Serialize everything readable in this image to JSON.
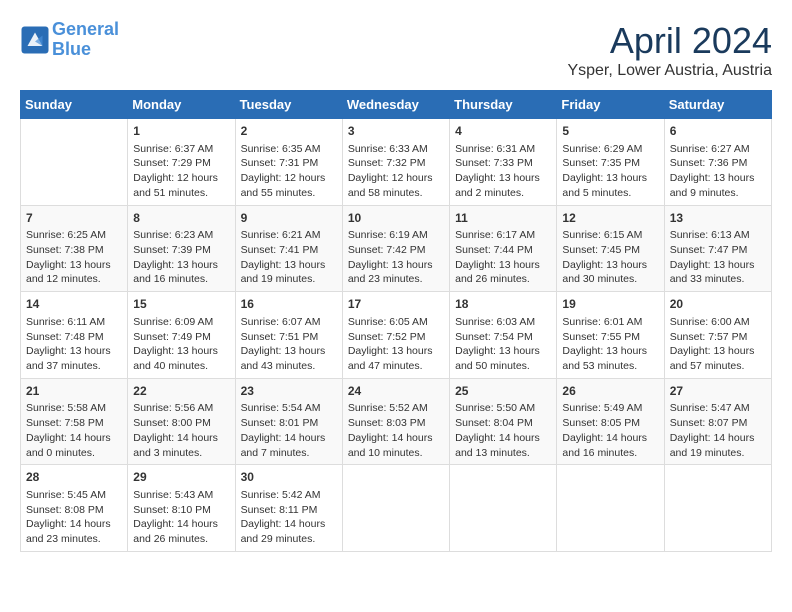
{
  "header": {
    "logo_line1": "General",
    "logo_line2": "Blue",
    "month": "April 2024",
    "location": "Ysper, Lower Austria, Austria"
  },
  "days_of_week": [
    "Sunday",
    "Monday",
    "Tuesday",
    "Wednesday",
    "Thursday",
    "Friday",
    "Saturday"
  ],
  "weeks": [
    [
      {
        "day": "",
        "info": ""
      },
      {
        "day": "1",
        "info": "Sunrise: 6:37 AM\nSunset: 7:29 PM\nDaylight: 12 hours\nand 51 minutes."
      },
      {
        "day": "2",
        "info": "Sunrise: 6:35 AM\nSunset: 7:31 PM\nDaylight: 12 hours\nand 55 minutes."
      },
      {
        "day": "3",
        "info": "Sunrise: 6:33 AM\nSunset: 7:32 PM\nDaylight: 12 hours\nand 58 minutes."
      },
      {
        "day": "4",
        "info": "Sunrise: 6:31 AM\nSunset: 7:33 PM\nDaylight: 13 hours\nand 2 minutes."
      },
      {
        "day": "5",
        "info": "Sunrise: 6:29 AM\nSunset: 7:35 PM\nDaylight: 13 hours\nand 5 minutes."
      },
      {
        "day": "6",
        "info": "Sunrise: 6:27 AM\nSunset: 7:36 PM\nDaylight: 13 hours\nand 9 minutes."
      }
    ],
    [
      {
        "day": "7",
        "info": "Sunrise: 6:25 AM\nSunset: 7:38 PM\nDaylight: 13 hours\nand 12 minutes."
      },
      {
        "day": "8",
        "info": "Sunrise: 6:23 AM\nSunset: 7:39 PM\nDaylight: 13 hours\nand 16 minutes."
      },
      {
        "day": "9",
        "info": "Sunrise: 6:21 AM\nSunset: 7:41 PM\nDaylight: 13 hours\nand 19 minutes."
      },
      {
        "day": "10",
        "info": "Sunrise: 6:19 AM\nSunset: 7:42 PM\nDaylight: 13 hours\nand 23 minutes."
      },
      {
        "day": "11",
        "info": "Sunrise: 6:17 AM\nSunset: 7:44 PM\nDaylight: 13 hours\nand 26 minutes."
      },
      {
        "day": "12",
        "info": "Sunrise: 6:15 AM\nSunset: 7:45 PM\nDaylight: 13 hours\nand 30 minutes."
      },
      {
        "day": "13",
        "info": "Sunrise: 6:13 AM\nSunset: 7:47 PM\nDaylight: 13 hours\nand 33 minutes."
      }
    ],
    [
      {
        "day": "14",
        "info": "Sunrise: 6:11 AM\nSunset: 7:48 PM\nDaylight: 13 hours\nand 37 minutes."
      },
      {
        "day": "15",
        "info": "Sunrise: 6:09 AM\nSunset: 7:49 PM\nDaylight: 13 hours\nand 40 minutes."
      },
      {
        "day": "16",
        "info": "Sunrise: 6:07 AM\nSunset: 7:51 PM\nDaylight: 13 hours\nand 43 minutes."
      },
      {
        "day": "17",
        "info": "Sunrise: 6:05 AM\nSunset: 7:52 PM\nDaylight: 13 hours\nand 47 minutes."
      },
      {
        "day": "18",
        "info": "Sunrise: 6:03 AM\nSunset: 7:54 PM\nDaylight: 13 hours\nand 50 minutes."
      },
      {
        "day": "19",
        "info": "Sunrise: 6:01 AM\nSunset: 7:55 PM\nDaylight: 13 hours\nand 53 minutes."
      },
      {
        "day": "20",
        "info": "Sunrise: 6:00 AM\nSunset: 7:57 PM\nDaylight: 13 hours\nand 57 minutes."
      }
    ],
    [
      {
        "day": "21",
        "info": "Sunrise: 5:58 AM\nSunset: 7:58 PM\nDaylight: 14 hours\nand 0 minutes."
      },
      {
        "day": "22",
        "info": "Sunrise: 5:56 AM\nSunset: 8:00 PM\nDaylight: 14 hours\nand 3 minutes."
      },
      {
        "day": "23",
        "info": "Sunrise: 5:54 AM\nSunset: 8:01 PM\nDaylight: 14 hours\nand 7 minutes."
      },
      {
        "day": "24",
        "info": "Sunrise: 5:52 AM\nSunset: 8:03 PM\nDaylight: 14 hours\nand 10 minutes."
      },
      {
        "day": "25",
        "info": "Sunrise: 5:50 AM\nSunset: 8:04 PM\nDaylight: 14 hours\nand 13 minutes."
      },
      {
        "day": "26",
        "info": "Sunrise: 5:49 AM\nSunset: 8:05 PM\nDaylight: 14 hours\nand 16 minutes."
      },
      {
        "day": "27",
        "info": "Sunrise: 5:47 AM\nSunset: 8:07 PM\nDaylight: 14 hours\nand 19 minutes."
      }
    ],
    [
      {
        "day": "28",
        "info": "Sunrise: 5:45 AM\nSunset: 8:08 PM\nDaylight: 14 hours\nand 23 minutes."
      },
      {
        "day": "29",
        "info": "Sunrise: 5:43 AM\nSunset: 8:10 PM\nDaylight: 14 hours\nand 26 minutes."
      },
      {
        "day": "30",
        "info": "Sunrise: 5:42 AM\nSunset: 8:11 PM\nDaylight: 14 hours\nand 29 minutes."
      },
      {
        "day": "",
        "info": ""
      },
      {
        "day": "",
        "info": ""
      },
      {
        "day": "",
        "info": ""
      },
      {
        "day": "",
        "info": ""
      }
    ]
  ]
}
